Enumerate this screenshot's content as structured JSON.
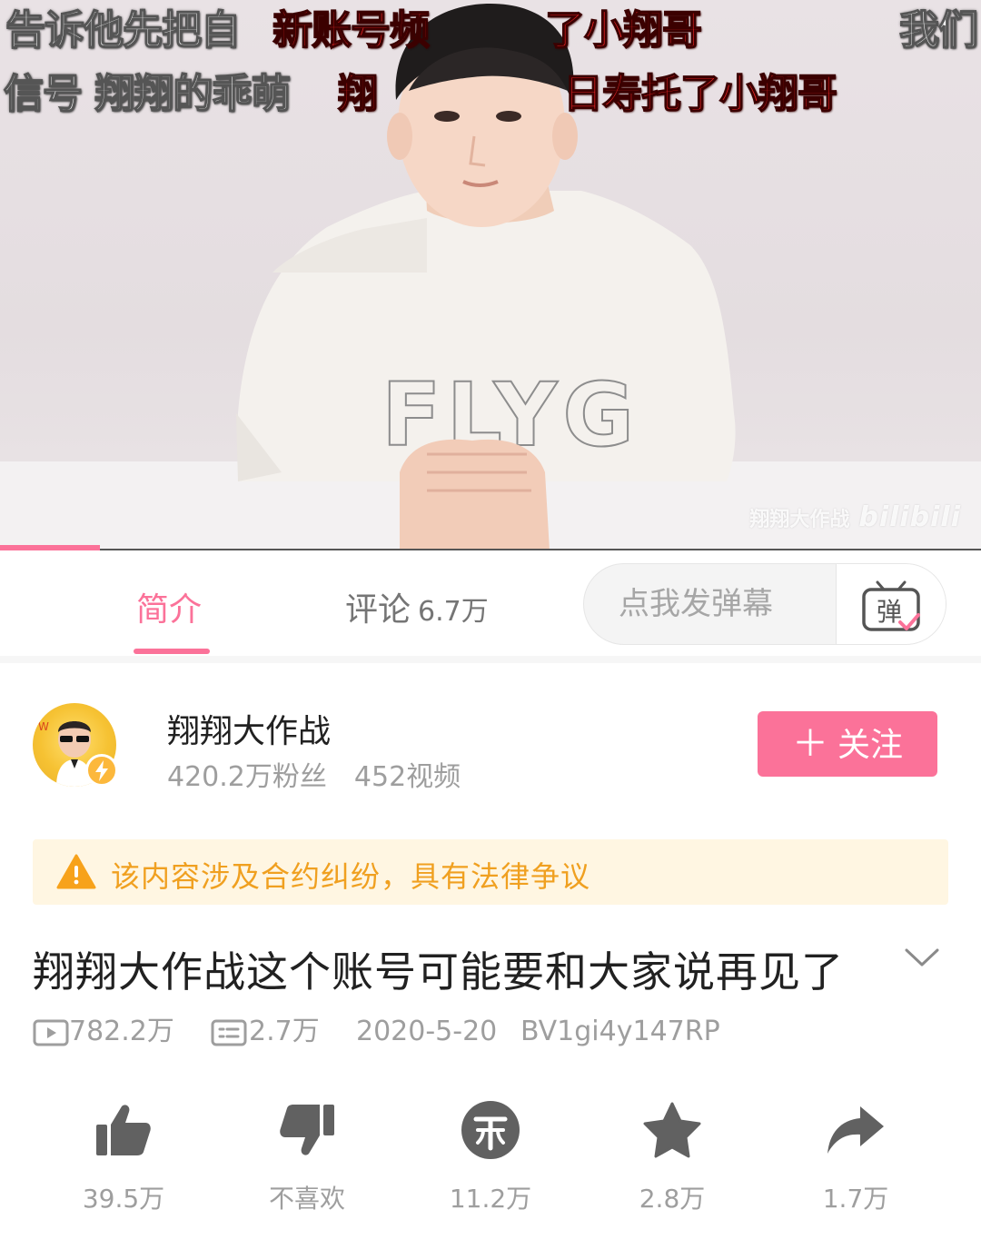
{
  "player": {
    "danmaku": [
      {
        "text": "告诉他先把自",
        "color": "white"
      },
      {
        "text": "新账号频",
        "color": "red"
      },
      {
        "text": "了小翔哥",
        "color": "red"
      },
      {
        "text": "我们",
        "color": "white"
      },
      {
        "text": "信号  翔翔的乖萌",
        "color": "white"
      },
      {
        "text": "翔",
        "color": "red"
      },
      {
        "text": "日寿托了小翔哥",
        "color": "red"
      }
    ],
    "shirt_print": "FLYG",
    "watermark_text": "翔翔大作战",
    "watermark_logo": "bilibili",
    "progress": 0.102
  },
  "tabs": [
    {
      "label": "简介",
      "count": "",
      "active": true
    },
    {
      "label": "评论",
      "count": "6.7万",
      "active": false
    }
  ],
  "danmaku_input": {
    "placeholder": "点我发弹幕",
    "toggle_glyph": "弹"
  },
  "uploader": {
    "name": "翔翔大作战",
    "fans": "420.2万粉丝",
    "videos": "452视频",
    "follow_label": "关注",
    "follow_plus": "＋"
  },
  "warning": {
    "text": "该内容涉及合约纠纷，具有法律争议",
    "icon": "warning-triangle-icon"
  },
  "video": {
    "title": "翔翔大作战这个账号可能要和大家说再见了",
    "views": "782.2万",
    "danmaku_count": "2.7万",
    "date": "2020-5-20",
    "bvid": "BV1gi4y147RP"
  },
  "actions": [
    {
      "icon": "thumbs-up-icon",
      "label": "39.5万"
    },
    {
      "icon": "thumbs-down-icon",
      "label": "不喜欢"
    },
    {
      "icon": "coin-icon",
      "label": "11.2万"
    },
    {
      "icon": "star-icon",
      "label": "2.8万"
    },
    {
      "icon": "share-icon",
      "label": "1.7万"
    }
  ],
  "colors": {
    "accent": "#fb7299",
    "warning_bg": "#fff6e2",
    "warning_text": "#f0a020",
    "secondary_text": "#9e9e9e",
    "icon_gray": "#616161"
  }
}
